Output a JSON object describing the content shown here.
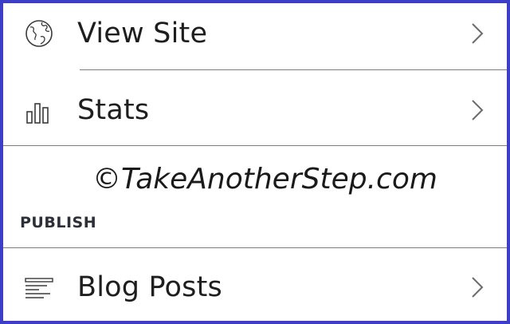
{
  "menu": {
    "items": [
      {
        "label": "View Site",
        "icon": "globe-icon"
      },
      {
        "label": "Stats",
        "icon": "bar-chart-icon"
      },
      {
        "label": "Blog Posts",
        "icon": "posts-list-icon"
      }
    ]
  },
  "watermark": "©TakeAnotherStep.com",
  "section": {
    "header": "PUBLISH"
  },
  "colors": {
    "frame_border": "#3d3dc8",
    "text": "#1e1e1e",
    "divider": "#7d7d7d",
    "chevron": "#6b6b6b"
  }
}
